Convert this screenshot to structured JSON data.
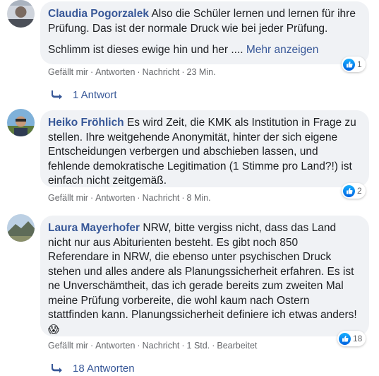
{
  "comments": [
    {
      "author": "Claudia Pogorzalek",
      "text_line1": "Also die Schüler lernen und lernen für ihre",
      "text_line2": "Prüfung. Das ist der normale Druck wie bei jeder Prüfung.",
      "text_line3": "Schlimm ist dieses ewige hin und her ....",
      "more_label": "Mehr anzeigen",
      "reaction_count": "1",
      "actions": {
        "like": "Gefällt mir",
        "reply": "Antworten",
        "message": "Nachricht",
        "time": "23 Min."
      },
      "replies_label": "1 Antwort"
    },
    {
      "author": "Heiko Fröhlich",
      "text_line1": "Es wird Zeit, die KMK als Institution in Frage zu",
      "text_line2": "stellen. Ihre weitgehende Anonymität, hinter der sich eigene",
      "text_line3": "Entscheidungen verbergen und abschieben lassen, und",
      "text_line4": "fehlende demokratische Legitimation (1 Stimme pro Land?!) ist",
      "text_line5": "einfach nicht zeitgemäß.",
      "reaction_count": "2",
      "actions": {
        "like": "Gefällt mir",
        "reply": "Antworten",
        "message": "Nachricht",
        "time": "8 Min."
      }
    },
    {
      "author": "Laura Mayerhofer",
      "text_line1": "NRW, bitte vergiss nicht, dass das Land",
      "text_line2": "nicht nur aus Abiturienten besteht. Es gibt noch 850",
      "text_line3": "Referendare in NRW, die ebenso unter psychischen Druck",
      "text_line4": "stehen und alles andere als Planungssicherheit erfahren. Es ist",
      "text_line5": "ne Unverschämtheit, das ich gerade bereits zum zweiten Mal",
      "text_line6": "meine Prüfung vorbereite, die wohl kaum nach Ostern",
      "text_line7": "stattfinden kann. Planungssicherheit definiere ich etwas anders!",
      "emoji": "😱",
      "reaction_count": "18",
      "actions": {
        "like": "Gefällt mir",
        "reply": "Antworten",
        "message": "Nachricht",
        "time": "1 Std.",
        "edited": "Bearbeitet"
      },
      "replies_label": "18 Antworten"
    }
  ],
  "colors": {
    "link": "#385898",
    "bubble": "#f0f2f5",
    "meta": "#65676b",
    "like_blue": "#1877f2"
  },
  "icons": {
    "reaction": "like-thumb-icon",
    "reply": "reply-arrow-icon"
  }
}
